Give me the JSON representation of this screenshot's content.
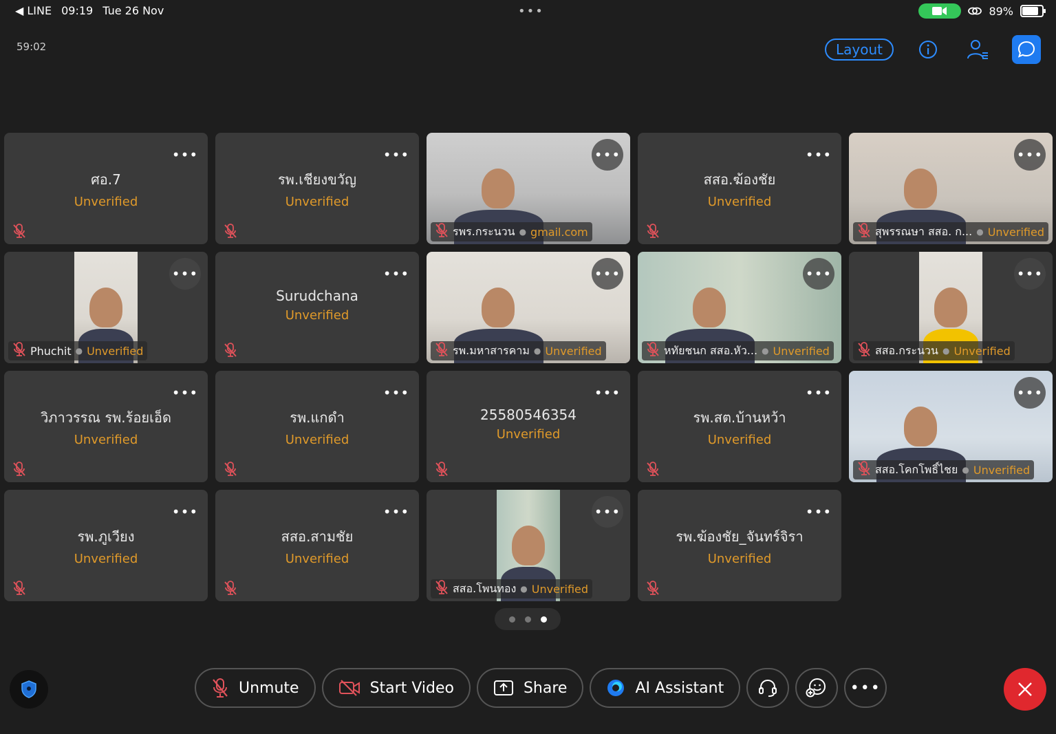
{
  "status_bar": {
    "back_app": "LINE",
    "time": "09:19",
    "date": "Tue 26 Nov",
    "battery": "89%",
    "battery_level": 0.89
  },
  "meeting": {
    "timer": "59:02",
    "layout_label": "Layout"
  },
  "participants": [
    {
      "name": "ศอ.7",
      "status": "Unverified",
      "video": false
    },
    {
      "name": "รพ.เชียงขวัญ",
      "status": "Unverified",
      "video": false
    },
    {
      "name": "รพร.กระนวน",
      "status": "gmail.com",
      "video": true
    },
    {
      "name": "สสอ.ฆ้องชัย",
      "status": "Unverified",
      "video": false
    },
    {
      "name": "สุพรรณษา สสอ. ก...",
      "status": "Unverified",
      "video": true
    },
    {
      "name": "Phuchit",
      "status": "Unverified",
      "video": true
    },
    {
      "name": "Surudchana",
      "status": "Unverified",
      "video": false
    },
    {
      "name": "รพ.มหาสารคาม",
      "status": "Unverified",
      "video": true
    },
    {
      "name": "หทัยชนก สสอ.หัว...",
      "status": "Unverified",
      "video": true
    },
    {
      "name": "สสอ.กระนวน",
      "status": "Unverified",
      "video": true
    },
    {
      "name": "วิภาวรรณ รพ.ร้อยเอ็ด",
      "status": "Unverified",
      "video": false
    },
    {
      "name": "รพ.แกดำ",
      "status": "Unverified",
      "video": false
    },
    {
      "name": "25580546354",
      "status": "Unverified",
      "video": false
    },
    {
      "name": "รพ.สต.บ้านหว้า",
      "status": "Unverified",
      "video": false
    },
    {
      "name": "สสอ.โคกโพธิ์ไชย",
      "status": "Unverified",
      "video": true
    },
    {
      "name": "รพ.ภูเวียง",
      "status": "Unverified",
      "video": false
    },
    {
      "name": "สสอ.สามชัย",
      "status": "Unverified",
      "video": false
    },
    {
      "name": "สสอ.โพนทอง",
      "status": "Unverified",
      "video": true
    },
    {
      "name": "รพ.ฆ้องชัย_จันทร์จิรา",
      "status": "Unverified",
      "video": false
    }
  ],
  "pager": {
    "pages": 3,
    "current": 3
  },
  "toolbar": {
    "unmute": "Unmute",
    "start_video": "Start Video",
    "share": "Share",
    "ai_assistant": "AI Assistant"
  },
  "colors": {
    "accent": "#2d8cff",
    "unverified": "#e09a2a",
    "end": "#e0282e",
    "mic_muted": "#e0525a"
  }
}
